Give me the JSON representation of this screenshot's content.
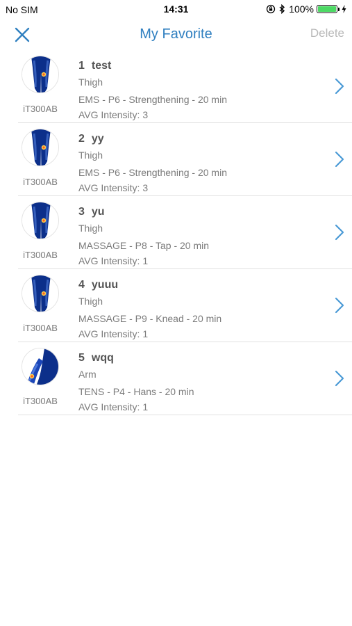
{
  "status_bar": {
    "carrier": "No SIM",
    "time": "14:31",
    "battery_percent": "100%",
    "battery_level": 1.0,
    "icons": [
      "orientation-lock-icon",
      "bluetooth-icon",
      "battery-icon",
      "charging-icon"
    ]
  },
  "nav": {
    "title": "My Favorite",
    "delete_label": "Delete",
    "close_icon": "close-icon"
  },
  "colors": {
    "accent": "#2f7fc0",
    "chevron": "#4a9ad6",
    "muted": "#7a7a7a",
    "disabled": "#b8b8b8",
    "battery_green": "#4cd964",
    "body_blue": "#0c2f8a"
  },
  "favorites": [
    {
      "index": "1",
      "name": "test",
      "part": "Thigh",
      "program": "EMS - P6 - Strengthening - 20 min",
      "intensity": "AVG Intensity: 3",
      "device": "iT300AB",
      "image": "thigh"
    },
    {
      "index": "2",
      "name": "yy",
      "part": "Thigh",
      "program": "EMS - P6 - Strengthening - 20 min",
      "intensity": "AVG Intensity: 3",
      "device": "iT300AB",
      "image": "thigh"
    },
    {
      "index": "3",
      "name": "yu",
      "part": "Thigh",
      "program": "MASSAGE - P8 - Tap - 20 min",
      "intensity": "AVG Intensity: 1",
      "device": "iT300AB",
      "image": "thigh"
    },
    {
      "index": "4",
      "name": "yuuu",
      "part": "Thigh",
      "program": "MASSAGE - P9 - Knead - 20 min",
      "intensity": "AVG Intensity: 1",
      "device": "iT300AB",
      "image": "thigh"
    },
    {
      "index": "5",
      "name": "wqq",
      "part": "Arm",
      "program": "TENS - P4 - Hans - 20 min",
      "intensity": "AVG Intensity: 1",
      "device": "iT300AB",
      "image": "arm"
    }
  ]
}
